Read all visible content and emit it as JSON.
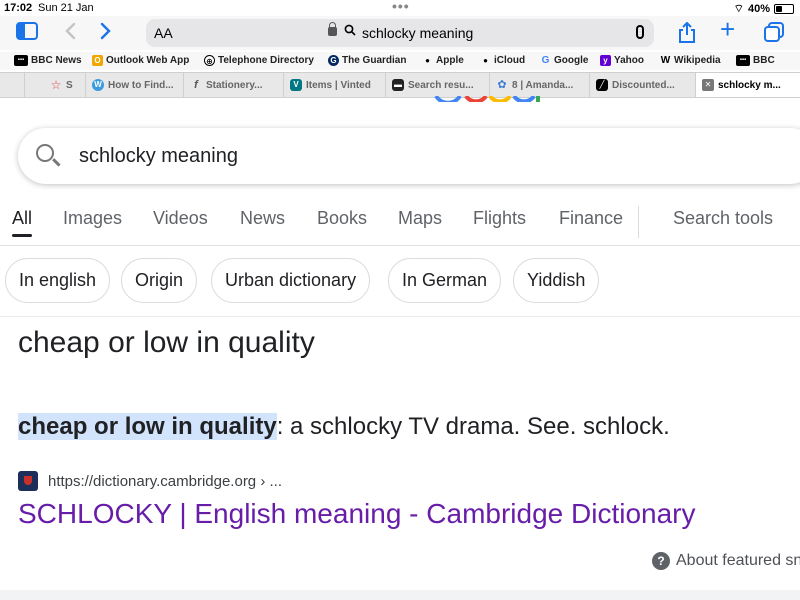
{
  "status": {
    "time": "17:02",
    "date": "Sun 21 Jan",
    "battery": "40%",
    "battery_level": 0.4
  },
  "toolbar": {
    "aa_label": "AA",
    "url_text": "schlocky meaning"
  },
  "bookmarks": [
    {
      "label": "BBC News",
      "icon": "bbc-icon"
    },
    {
      "label": "Outlook Web App",
      "icon": "outlook-icon"
    },
    {
      "label": "Telephone Directory",
      "icon": "globe-icon"
    },
    {
      "label": "The Guardian",
      "icon": "guardian-icon"
    },
    {
      "label": "Apple",
      "icon": "apple-icon"
    },
    {
      "label": "iCloud",
      "icon": "apple-icon"
    },
    {
      "label": "Google",
      "icon": "google-icon"
    },
    {
      "label": "Yahoo",
      "icon": "yahoo-icon"
    },
    {
      "label": "Wikipedia",
      "icon": "wikipedia-icon"
    },
    {
      "label": "BBC",
      "icon": "bbc-icon"
    }
  ],
  "tabs": [
    {
      "label": "",
      "icon": "pin-icon"
    },
    {
      "label": "S",
      "icon": "star-icon"
    },
    {
      "label": "How to Find...",
      "icon": "w-icon"
    },
    {
      "label": "Stationery...",
      "icon": "f-icon"
    },
    {
      "label": "Items | Vinted",
      "icon": "vinted-icon"
    },
    {
      "label": "Search resu...",
      "icon": "search-tab-icon"
    },
    {
      "label": "8 | Amanda...",
      "icon": "leaf-icon"
    },
    {
      "label": "Discounted...",
      "icon": "discount-icon"
    },
    {
      "label": "schlocky m...",
      "icon": "close-icon"
    }
  ],
  "search": {
    "query": "schlocky meaning"
  },
  "nav_tabs": [
    "All",
    "Images",
    "Videos",
    "News",
    "Books",
    "Maps",
    "Flights",
    "Finance"
  ],
  "search_tools": "Search tools",
  "chips": [
    "In english",
    "Origin",
    "Urban dictionary",
    "In German",
    "Yiddish"
  ],
  "result": {
    "answer": "cheap or low in quality",
    "snippet_highlight": "cheap or low in quality",
    "snippet_rest": ": a schlocky TV drama. See. schlock.",
    "source_url": "https://dictionary.cambridge.org › ...",
    "link_title": "SCHLOCKY | English meaning - Cambridge Dictionary",
    "about": "About featured sn"
  },
  "colors": {
    "accent": "#1a73e8",
    "link": "#681da8",
    "highlight": "#d2e3fc"
  }
}
